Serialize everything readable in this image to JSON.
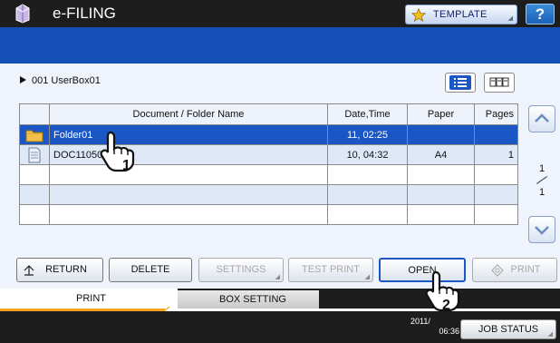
{
  "header": {
    "title": "e-FILING",
    "template_label": "TEMPLATE",
    "help_label": "?"
  },
  "breadcrumb": "001 UserBox01",
  "table": {
    "columns": [
      "",
      "Document / Folder Name",
      "Date,Time",
      "Paper",
      "Pages"
    ],
    "rows": [
      {
        "icon": "folder-icon",
        "name": "Folder01",
        "date": "11, 02:25",
        "paper": "",
        "pages": "",
        "selected": true
      },
      {
        "icon": "document-icon",
        "name": "DOC11050",
        "date": "10, 04:32",
        "paper": "A4",
        "pages": "1",
        "selected": false
      }
    ]
  },
  "pager": {
    "current": "1",
    "total": "1"
  },
  "buttons": {
    "return": "RETURN",
    "delete": "DELETE",
    "settings": "SETTINGS",
    "test_print": "TEST PRINT",
    "open": "OPEN",
    "print": "PRINT"
  },
  "tabs": {
    "print": "PRINT",
    "box_setting": "BOX SETTING"
  },
  "status": {
    "date": "2011/",
    "time": "06:36",
    "job_status": "JOB STATUS"
  },
  "callouts": {
    "step1": "1",
    "step2": "2"
  },
  "colors": {
    "accent_blue": "#1a56c4",
    "tab_orange": "#f7a21a",
    "band_blue": "#1550b8"
  }
}
